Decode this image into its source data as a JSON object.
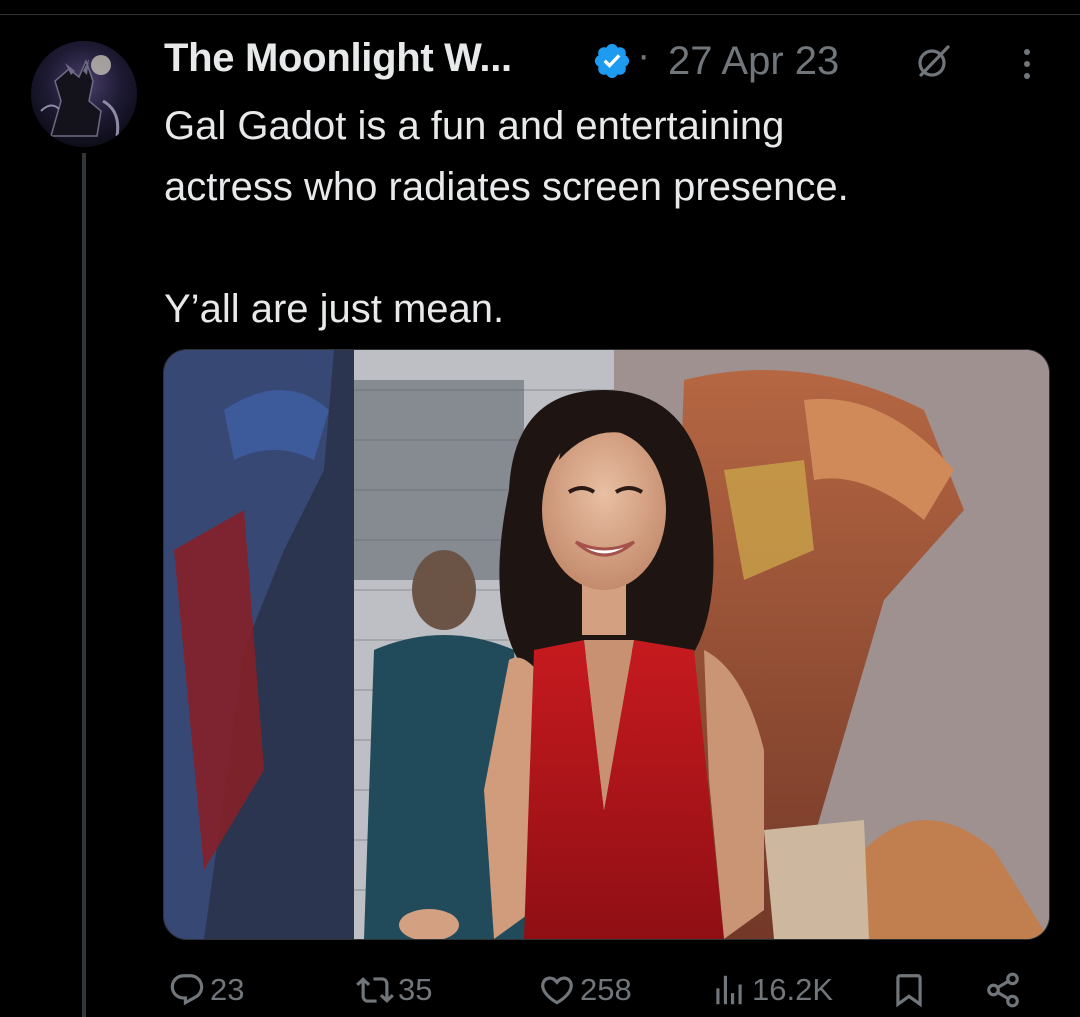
{
  "tweet": {
    "author_name": "The Moonlight W...",
    "separator": "·",
    "timestamp": "27 Apr 23",
    "text": "Gal Gadot is a fun and entertaining\nactress who radiates screen presence.\n\nY’all are just mean."
  },
  "actions": {
    "replies": "23",
    "retweets": "35",
    "likes": "258",
    "views": "16.2K"
  },
  "colors": {
    "background": "#000000",
    "text": "#e7e9ea",
    "muted": "#71767b",
    "verified": "#1d9bf0"
  },
  "icons": {
    "verified": "verified-badge-icon",
    "grok": "grok-icon",
    "more": "more-vertical-icon",
    "reply": "reply-icon",
    "retweet": "retweet-icon",
    "like": "like-icon",
    "views": "views-icon",
    "bookmark": "bookmark-icon",
    "share": "share-icon"
  }
}
